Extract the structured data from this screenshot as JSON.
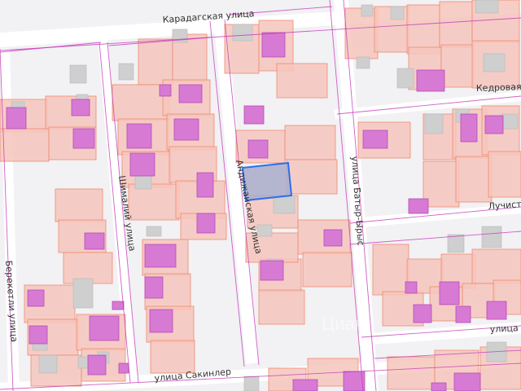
{
  "map": {
    "colors": {
      "background": "#f2f1f4",
      "street": "#ffffff",
      "parcel_fill": "#f6c5bc",
      "parcel_stroke": "#ee8a70",
      "building_fill": "#d77ad4",
      "building_stroke": "#b64cb6",
      "gray_building": "#cfcfcf",
      "boundary": "#c43ab8",
      "highlight_fill": "#a9acc9",
      "highlight_stroke": "#2a6ff0"
    },
    "streets": [
      {
        "id": "karadagskaya",
        "label": "Карадагская улица"
      },
      {
        "id": "kedrovaya",
        "label": "Кедровая"
      },
      {
        "id": "shimaliy",
        "label": "Шималий улица"
      },
      {
        "id": "andizhanskaya",
        "label": "Андижанская улица"
      },
      {
        "id": "batyr",
        "label": "улица Батыр-Ырыс"
      },
      {
        "id": "luchist",
        "label": "Лучист"
      },
      {
        "id": "bereketli",
        "label": "Берекетли улица"
      },
      {
        "id": "sakinler",
        "label": "улица Сакинлер"
      },
      {
        "id": "ulitsa",
        "label": "улица"
      }
    ],
    "watermark_text": "Циан"
  }
}
